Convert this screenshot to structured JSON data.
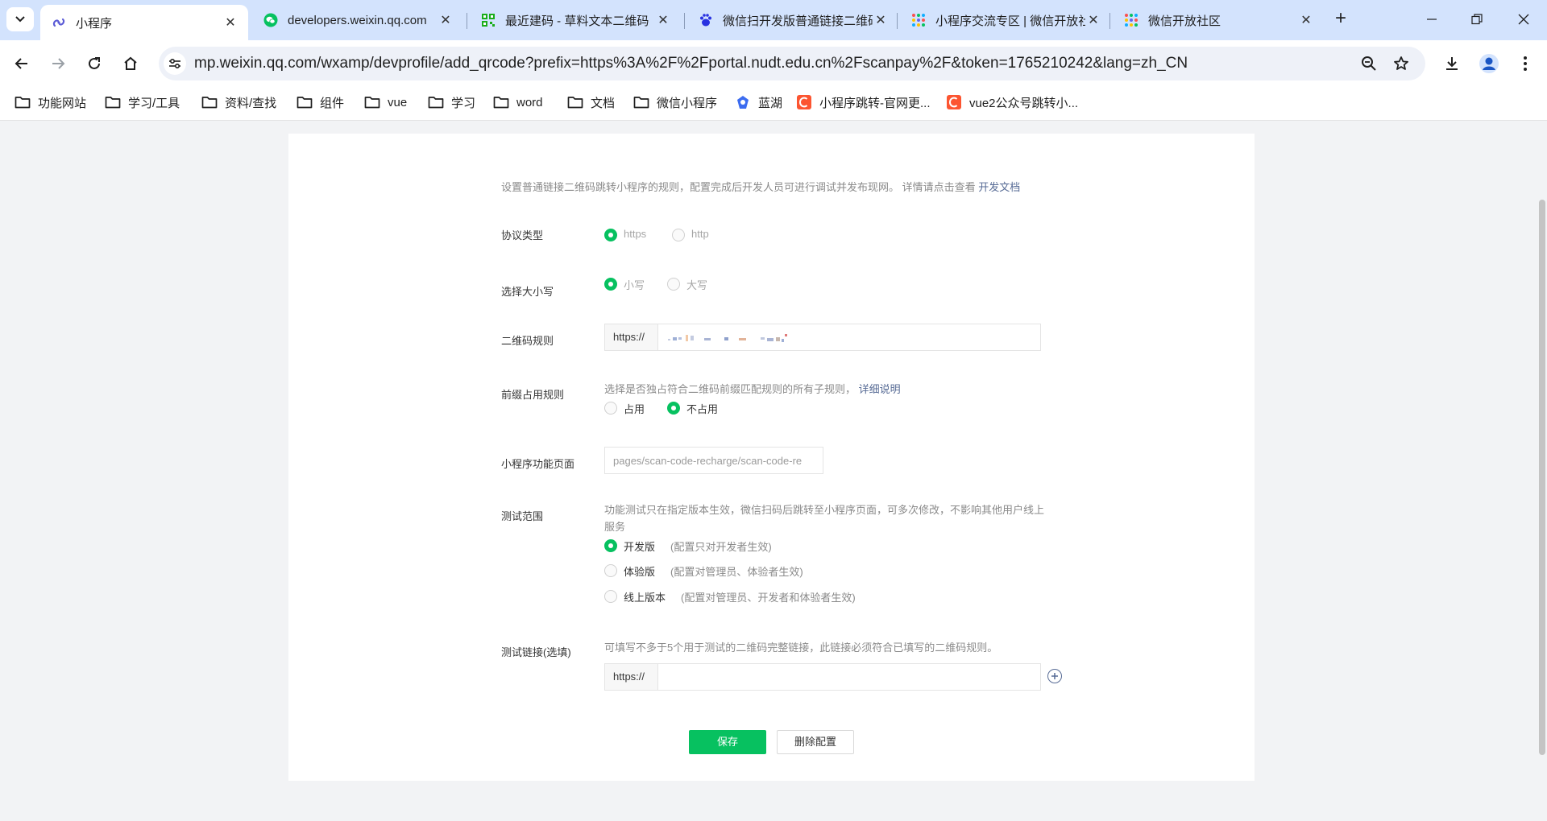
{
  "browser": {
    "tabs": [
      {
        "title": "小程序",
        "icon": "link-icon",
        "active": true
      },
      {
        "title": "developers.weixin.qq.com",
        "icon": "wechat-icon"
      },
      {
        "title": "最近建码 - 草料文本二维码",
        "icon": "qrcode-icon"
      },
      {
        "title": "微信扫开发版普通链接二维码",
        "icon": "baidu-paw-icon"
      },
      {
        "title": "小程序交流专区 | 微信开放社区",
        "icon": "dots-grid-icon"
      },
      {
        "title": "微信开放社区",
        "icon": "dots-grid-icon"
      }
    ],
    "url": "mp.weixin.qq.com/wxamp/devprofile/add_qrcode?prefix=https%3A%2F%2Fportal.nudt.edu.cn%2Fscanpay%2F&token=1765210242&lang=zh_CN",
    "bookmarks": [
      {
        "label": "功能网站",
        "icon": "folder-icon"
      },
      {
        "label": "学习/工具",
        "icon": "folder-icon"
      },
      {
        "label": "资料/查找",
        "icon": "folder-icon"
      },
      {
        "label": "组件",
        "icon": "folder-icon"
      },
      {
        "label": "vue",
        "icon": "folder-icon"
      },
      {
        "label": "学习",
        "icon": "folder-icon"
      },
      {
        "label": "word",
        "icon": "folder-icon"
      },
      {
        "label": "文档",
        "icon": "folder-icon"
      },
      {
        "label": "微信小程序",
        "icon": "folder-icon"
      },
      {
        "label": "蓝湖",
        "icon": "lanhu-icon"
      },
      {
        "label": "小程序跳转-官网更...",
        "icon": "csdn-icon"
      },
      {
        "label": "vue2公众号跳转小...",
        "icon": "csdn-icon"
      }
    ]
  },
  "form": {
    "intro": "设置普通链接二维码跳转小程序的规则，配置完成后开发人员可进行调试并发布现网。 详情请点击查看",
    "intro_link": "开发文档",
    "protocol": {
      "label": "协议类型",
      "options": [
        "https",
        "http"
      ],
      "selected": "https"
    },
    "case": {
      "label": "选择大小写",
      "options": [
        "小写",
        "大写"
      ],
      "selected": "小写"
    },
    "qr_rule": {
      "label": "二维码规则",
      "prefix": "https://",
      "value_masked": true
    },
    "prefix_rule": {
      "label": "前缀占用规则",
      "hint": "选择是否独占符合二维码前缀匹配规则的所有子规则，",
      "hint_link": "详细说明",
      "options": [
        "占用",
        "不占用"
      ],
      "selected": "不占用"
    },
    "page": {
      "label": "小程序功能页面",
      "value": "pages/scan-code-recharge/scan-code-re"
    },
    "test_scope": {
      "label": "测试范围",
      "hint": "功能测试只在指定版本生效，微信扫码后跳转至小程序页面，可多次修改，不影响其他用户线上服务",
      "options": [
        {
          "label": "开发版",
          "note": "(配置只对开发者生效)"
        },
        {
          "label": "体验版",
          "note": "(配置对管理员、体验者生效)"
        },
        {
          "label": "线上版本",
          "note": "(配置对管理员、开发者和体验者生效)"
        }
      ],
      "selected": "开发版"
    },
    "test_link": {
      "label": "测试链接(选填)",
      "hint": "可填写不多于5个用于测试的二维码完整链接，此链接必须符合已填写的二维码规则。",
      "prefix": "https://",
      "value": ""
    },
    "save_label": "保存",
    "delete_label": "删除配置"
  },
  "colors": {
    "accent": "#07c160",
    "link": "#576b95",
    "tabstrip": "#d3e3fd"
  }
}
